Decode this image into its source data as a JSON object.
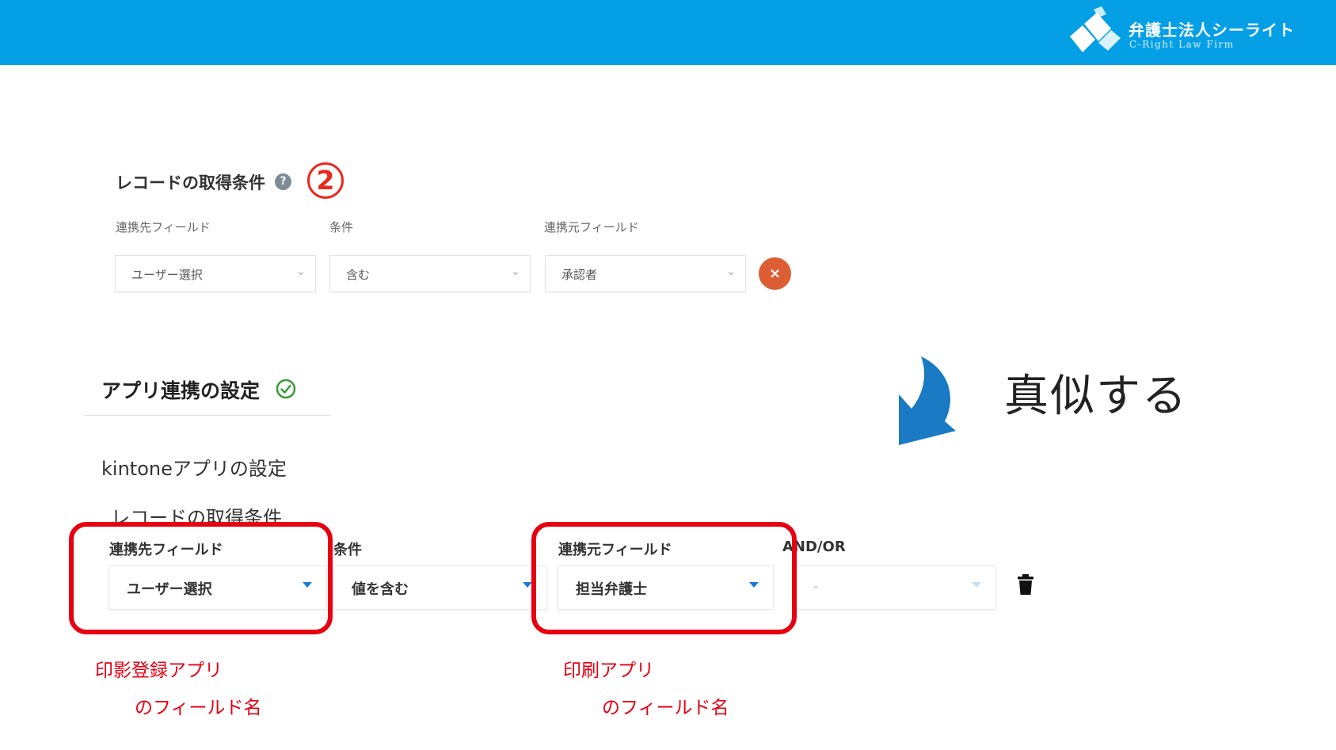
{
  "header": {
    "logo_jp": "弁護士法人シーライト",
    "logo_en": "C-Right Law Firm",
    "logo_icon": "firm-logo-icon",
    "background_color": "#059fe5"
  },
  "old_ui": {
    "title": "レコードの取得条件",
    "help_icon_text": "?",
    "step_number": "2",
    "labels": [
      "連携先フィールド",
      "条件",
      "連携元フィールド"
    ],
    "selects": [
      {
        "value": "ユーザー選択"
      },
      {
        "value": "含む"
      },
      {
        "value": "承認者"
      }
    ],
    "remove_button_text": "×",
    "remove_button_color": "#dd5e35"
  },
  "new_ui": {
    "section_title": "アプリ連携の設定",
    "sub_title": "kintoneアプリの設定",
    "sub_sub_title": "レコードの取得条件",
    "labels": [
      "連携先フィールド",
      "条件",
      "連携元フィールド",
      "AND/OR"
    ],
    "selects": [
      {
        "value": "ユーザー選択"
      },
      {
        "value": "値を含む"
      },
      {
        "value": "担当弁護士"
      },
      {
        "value": "-"
      }
    ],
    "status_icon": "check-circle-icon",
    "delete_icon": "trash-icon",
    "caret_color": "#1a7ad6"
  },
  "annotation": {
    "mimic_text": "真似する",
    "arrow_color": "#1a7bc4",
    "highlight_color": "#e60012",
    "notes": [
      {
        "line1": "印影登録アプリ",
        "line2": "のフィールド名"
      },
      {
        "line1": "印刷アプリ",
        "line2": "のフィールド名"
      }
    ]
  }
}
